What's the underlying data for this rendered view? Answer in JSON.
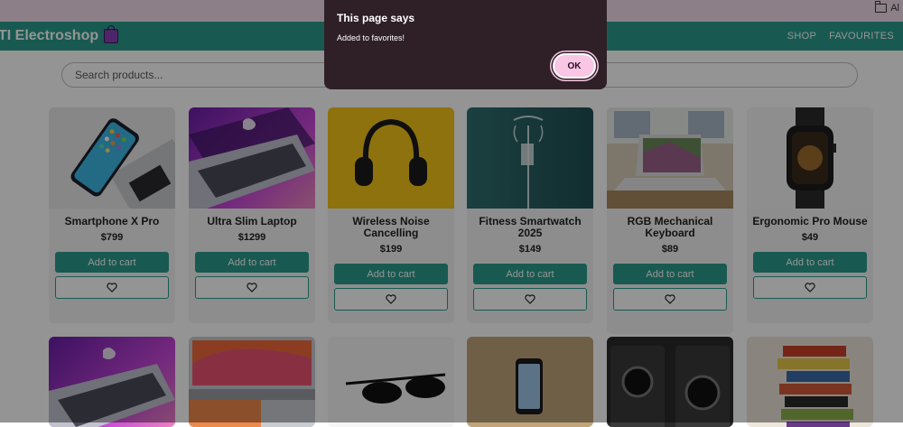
{
  "browser": {
    "bookmark_label": "Al"
  },
  "nav": {
    "brand": "TI Electroshop",
    "links": [
      "SHOP",
      "FAVOURITES"
    ]
  },
  "search": {
    "placeholder": "Search products..."
  },
  "products": [
    {
      "name": "Smartphone X Pro",
      "price": "$799",
      "add_label": "Add to cart"
    },
    {
      "name": "Ultra Slim Laptop",
      "price": "$1299",
      "add_label": "Add to cart"
    },
    {
      "name": "Wireless Noise Cancelling",
      "price": "$199",
      "add_label": "Add to cart"
    },
    {
      "name": "Fitness Smartwatch 2025",
      "price": "$149",
      "add_label": "Add to cart"
    },
    {
      "name": "RGB Mechanical Keyboard",
      "price": "$89",
      "add_label": "Add to cart"
    },
    {
      "name": "Ergonomic Pro Mouse",
      "price": "$49",
      "add_label": "Add to cart"
    }
  ],
  "dialog": {
    "title": "This page says",
    "message": "Added to favorites!",
    "ok_label": "OK"
  },
  "icons": {
    "favorite": "heart-icon",
    "folder": "folder-icon",
    "brand": "shopping-bag-icon"
  }
}
